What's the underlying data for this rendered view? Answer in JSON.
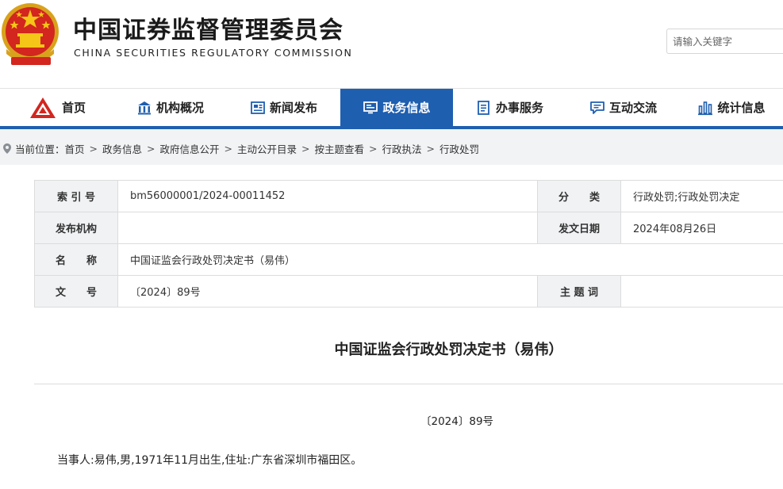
{
  "header": {
    "title_cn": "中国证券监督管理委员会",
    "title_en": "CHINA SECURITIES REGULATORY COMMISSION",
    "search_placeholder": "请输入关键字"
  },
  "nav": {
    "items": [
      {
        "label": "首页",
        "icon": "csrc-logo-icon"
      },
      {
        "label": "机构概况",
        "icon": "building-icon"
      },
      {
        "label": "新闻发布",
        "icon": "newspaper-icon"
      },
      {
        "label": "政务信息",
        "icon": "monitor-icon",
        "active": true
      },
      {
        "label": "办事服务",
        "icon": "document-list-icon"
      },
      {
        "label": "互动交流",
        "icon": "chat-bubble-icon"
      },
      {
        "label": "统计信息",
        "icon": "bar-chart-icon"
      }
    ],
    "active_color": "#1f5fb0"
  },
  "breadcrumb": {
    "label": "当前位置：",
    "items": [
      "首页",
      "政务信息",
      "政府信息公开",
      "主动公开目录",
      "按主题查看",
      "行政执法",
      "行政处罚"
    ]
  },
  "meta": {
    "index_label": "索 引 号",
    "index_value": "bm56000001/2024-00011452",
    "category_label": "分　　类",
    "category_value": "行政处罚;行政处罚决定",
    "issuer_label": "发布机构",
    "issuer_value": "",
    "date_label": "发文日期",
    "date_value": "2024年08月26日",
    "name_label": "名　　称",
    "name_value": "中国证监会行政处罚决定书（易伟）",
    "docno_label": "文　　号",
    "docno_value": "〔2024〕89号",
    "keywords_label": "主 题 词",
    "keywords_value": ""
  },
  "document": {
    "title": "中国证监会行政处罚决定书（易伟）",
    "number": "〔2024〕89号",
    "party": "当事人:易伟,男,1971年11月出生,住址:广东省深圳市福田区。"
  }
}
